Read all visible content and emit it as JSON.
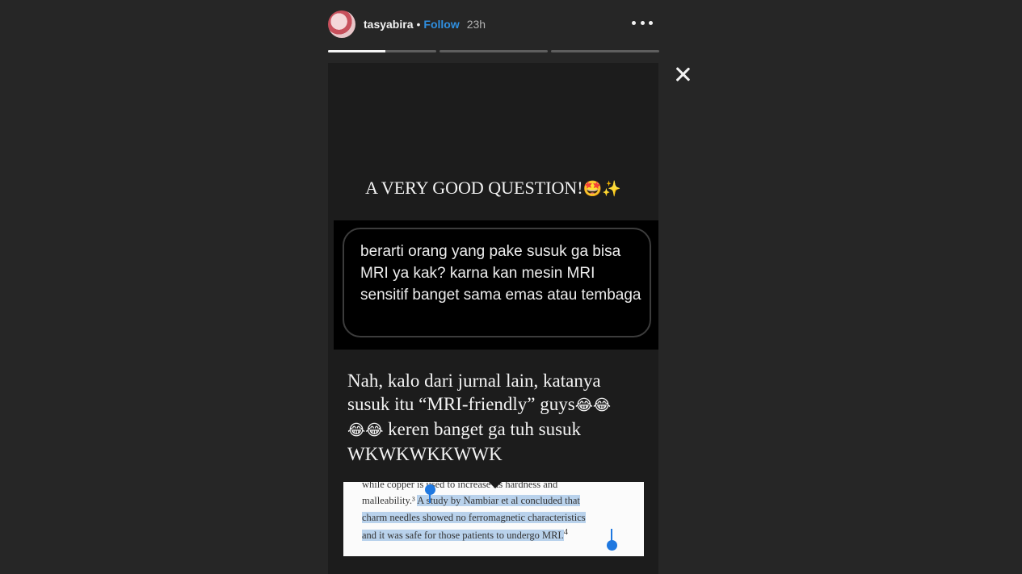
{
  "header": {
    "username": "tasyabira",
    "separator": "•",
    "follow_label": "Follow",
    "time": "23h",
    "avatar_icon": "profile-avatar",
    "more_icon": "more-options-icon"
  },
  "progress": {
    "segments": 3,
    "current_index": 0,
    "current_fill_fraction": 0.53
  },
  "close_icon": "close-icon",
  "story": {
    "headline": "A VERY GOOD QUESTION!",
    "headline_emoji": "🤩✨",
    "question": "berarti orang yang pake susuk ga bisa MRI ya kak? karna kan mesin MRI sensitif banget sama emas atau tembaga",
    "answer_line1": "Nah, kalo dari jurnal lain, katanya",
    "answer_line2": "susuk itu “MRI-friendly” guys",
    "answer_emoji_a": "😂😂",
    "answer_emoji_b": "😂😂",
    "answer_line3": "keren banget ga tuh susuk",
    "answer_line4": "WKWKWKKWWK",
    "journal": {
      "line1": "while copper is used to increase its hardness and",
      "line2_plain": "malleability.³",
      "line2_highlight": "A study by Nambiar et al concluded that",
      "line3_highlight": "charm needles showed no ferromagnetic characteristics",
      "line4_highlight": "and it was safe for those patients to undergo MRI.",
      "line4_sup": "4"
    }
  },
  "colors": {
    "background": "#262626",
    "follow": "#2f8fe0",
    "highlight": "#b9d2ec",
    "selection_handle": "#1f78e0"
  }
}
